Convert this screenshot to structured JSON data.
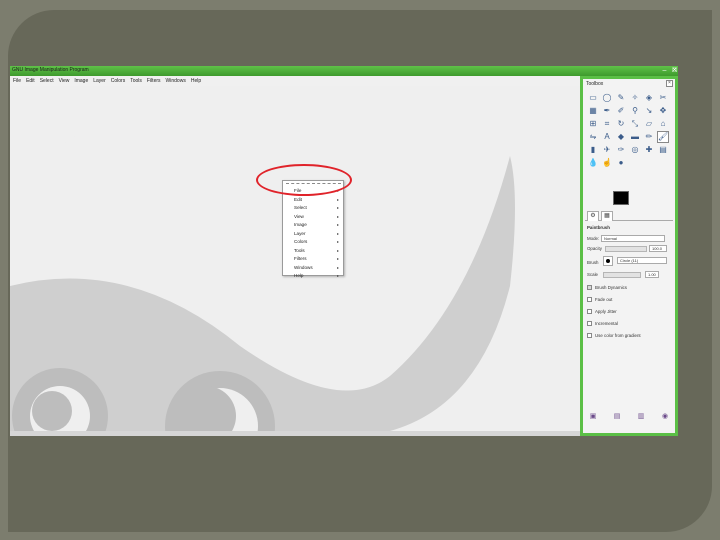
{
  "window": {
    "title": "GNU Image Manipulation Program",
    "minimize": "–",
    "maximize": "□",
    "close": "✕"
  },
  "menubar": [
    "File",
    "Edit",
    "Select",
    "View",
    "Image",
    "Layer",
    "Colors",
    "Tools",
    "Filters",
    "Windows",
    "Help"
  ],
  "context_menu": {
    "items": [
      "File",
      "Edit",
      "Select",
      "View",
      "Image",
      "Layer",
      "Colors",
      "Tools",
      "Filters",
      "Windows",
      "Help"
    ],
    "submenu_arrow": "▸"
  },
  "toolbox": {
    "title": "Toolbox",
    "close": "×",
    "tools": [
      "rect-select-icon",
      "ellipse-select-icon",
      "free-select-icon",
      "fuzzy-select-icon",
      "select-by-color-icon",
      "scissors-icon",
      "foreground-select-icon",
      "paths-icon",
      "color-picker-icon",
      "zoom-icon",
      "measure-icon",
      "move-icon",
      "align-icon",
      "crop-icon",
      "rotate-icon",
      "scale-icon",
      "shear-icon",
      "perspective-icon",
      "flip-icon",
      "text-icon",
      "bucket-fill-icon",
      "blend-icon",
      "pencil-icon",
      "paintbrush-icon",
      "eraser-icon",
      "airbrush-icon",
      "ink-icon",
      "clone-icon",
      "heal-icon",
      "perspective-clone-icon",
      "blur-icon",
      "smudge-icon",
      "dodge-icon"
    ],
    "tool_glyphs": [
      "▭",
      "◯",
      "✎",
      "✧",
      "◈",
      "✂",
      "▦",
      "✒",
      "✐",
      "⚲",
      "↘",
      "✥",
      "⊞",
      "⌗",
      "↻",
      "⤡",
      "▱",
      "⌂",
      "⇋",
      "A",
      "◆",
      "▬",
      "✏",
      "🖌",
      "▮",
      "✈",
      "✑",
      "◎",
      "✚",
      "▤",
      "💧",
      "☝",
      "●"
    ],
    "active_tool_index": 23,
    "tabs": [
      "⚙",
      "▦"
    ],
    "options": {
      "heading": "Paintbrush",
      "mode_label": "Mode:",
      "mode_value": "Normal",
      "opacity_label": "Opacity",
      "opacity_value": "100.0",
      "brush_label": "Brush",
      "brush_value": "Circle (11)",
      "scale_label": "Scale",
      "scale_value": "1.00",
      "checkboxes": [
        "Brush Dynamics",
        "Fade out",
        "Apply Jitter",
        "Incremental",
        "Use color from gradient"
      ],
      "checked": [
        true,
        false,
        false,
        false,
        false
      ]
    },
    "bottom_icons": [
      "save-options-icon",
      "restore-options-icon",
      "delete-options-icon",
      "reset-options-icon"
    ],
    "bottom_glyphs": [
      "▣",
      "▤",
      "▥",
      "◉"
    ]
  },
  "colors": {
    "slide_bg": "#7c7d6e",
    "slide_frame": "#676859",
    "titlebar": "#4fae3b",
    "canvas": "#efefef",
    "wilber_shape": "#cfcfcf",
    "highlight_ring": "#e0232a"
  }
}
